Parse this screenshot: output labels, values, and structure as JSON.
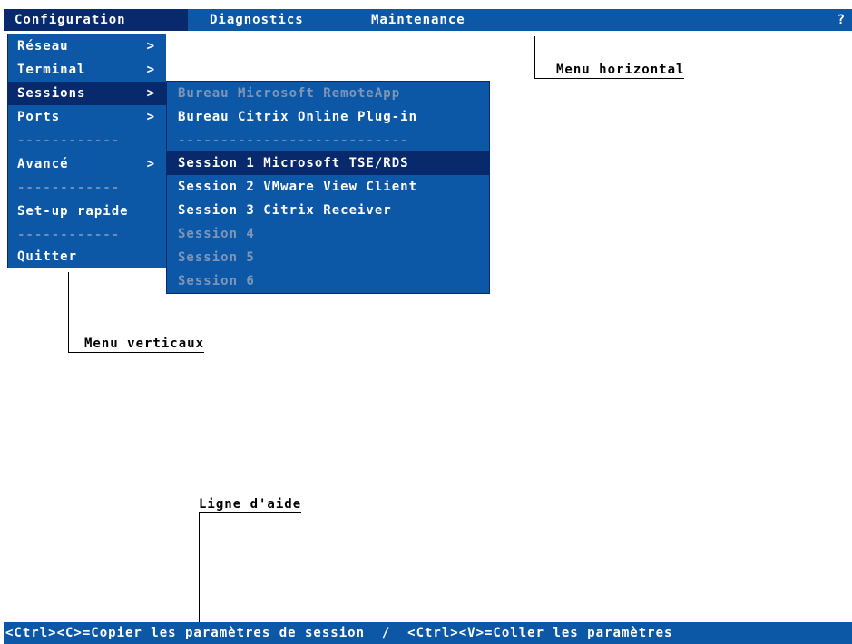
{
  "menubar": {
    "items": [
      {
        "label": "Configuration",
        "active": true
      },
      {
        "label": "Diagnostics",
        "active": false
      },
      {
        "label": "Maintenance",
        "active": false
      }
    ],
    "help": "?"
  },
  "vertical_menu": {
    "items": [
      {
        "label": "Réseau",
        "arrow": ">"
      },
      {
        "label": "Terminal",
        "arrow": ">"
      },
      {
        "label": "Sessions",
        "arrow": ">"
      },
      {
        "label": "Ports",
        "arrow": ">"
      },
      {
        "label": "------------"
      },
      {
        "label": "Avancé",
        "arrow": ">"
      },
      {
        "label": "------------"
      },
      {
        "label": "Set-up rapide"
      },
      {
        "label": "------------"
      },
      {
        "label": "Quitter"
      }
    ]
  },
  "sessions_submenu": {
    "items": [
      {
        "label": "Bureau Microsoft RemoteApp"
      },
      {
        "label": "Bureau Citrix Online Plug-in"
      },
      {
        "label": "---------------------------"
      },
      {
        "label": "Session 1 Microsoft TSE/RDS"
      },
      {
        "label": "Session 2 VMware View Client"
      },
      {
        "label": "Session 3 Citrix Receiver"
      },
      {
        "label": "Session 4"
      },
      {
        "label": "Session 5"
      },
      {
        "label": "Session 6"
      }
    ]
  },
  "annotations": {
    "menu_horizontal": "Menu horizontal",
    "menu_verticaux": "Menu verticaux",
    "ligne_aide": "Ligne d'aide"
  },
  "help_line": "<Ctrl><C>=Copier les paramètres de session  /  <Ctrl><V>=Coller les paramètres",
  "colors": {
    "menu_bg": "#0d58a6",
    "selected_bg": "#08296b",
    "disabled_text": "#7f95b8"
  }
}
